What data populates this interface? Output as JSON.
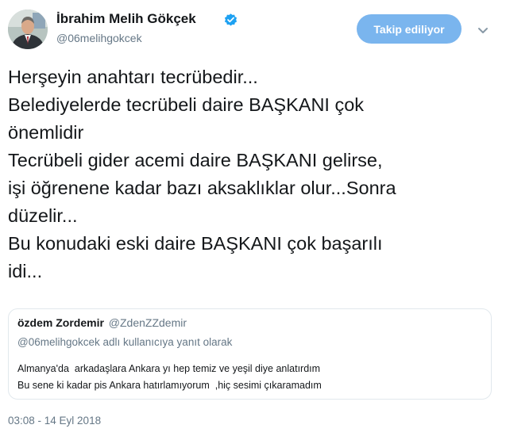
{
  "author": {
    "name": "İbrahim Melih Gökçek",
    "handle": "@06melihgokcek",
    "verified": true
  },
  "follow_button": {
    "label": "Takip ediliyor"
  },
  "icons": {
    "avatar": "profile-photo",
    "verified": "verified-badge-icon",
    "menu": "chevron-down-icon"
  },
  "tweet": {
    "lines": [
      "Herşeyin anahtarı tecrübedir...",
      "Belediyelerde tecrübeli daire BAŞKANI çok",
      "önemlidir",
      "Tecrübeli gider acemi daire BAŞKANI gelirse,",
      "işi öğrenene kadar bazı aksaklıklar olur...Sonra",
      "düzelir...",
      "Bu konudaki eski daire BAŞKANI çok başarılı",
      "idi..."
    ]
  },
  "quoted_tweet": {
    "name": "özdem Zordemir",
    "handle": "@ZdenZZdemir",
    "reply_context": "@06melihgokcek adlı kullanıcıya yanıt olarak",
    "lines": [
      "Almanya'da  arkadaşlara Ankara yı hep temiz ve yeşil diye anlatırdım",
      "Bu sene ki kadar pis Ankara hatırlamıyorum  ,hiç sesimi çıkaramadım"
    ]
  },
  "timestamp": "03:08 - 14 Eyl 2018",
  "colors": {
    "follow_button_bg": "#7ab5ee",
    "verified_badge": "#1da1f2",
    "secondary_text": "#657786",
    "card_border": "#e1e8ed"
  }
}
